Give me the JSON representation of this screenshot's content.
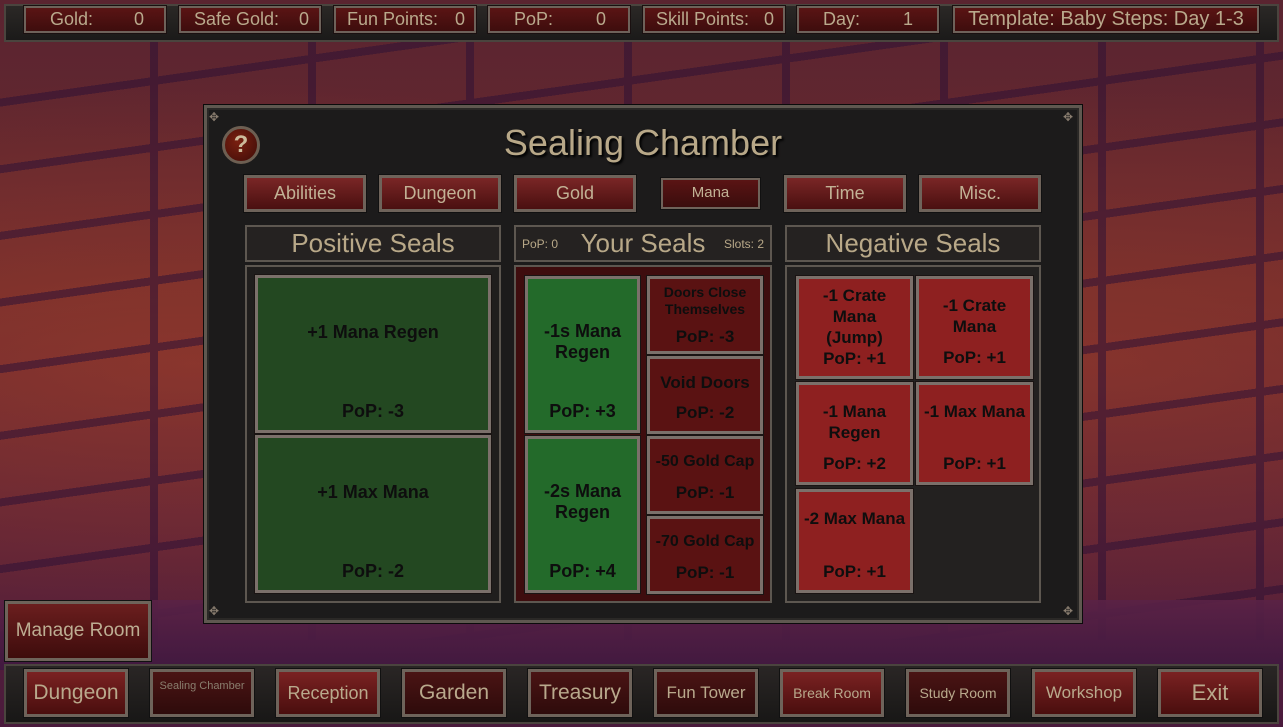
{
  "top_bar": {
    "stats": [
      {
        "label": "Gold:",
        "value": "0"
      },
      {
        "label": "Safe Gold:",
        "value": "0"
      },
      {
        "label": "Fun Points:",
        "value": "0"
      },
      {
        "label": "PoP:",
        "value": "0"
      },
      {
        "label": "Skill Points:",
        "value": "0"
      },
      {
        "label": "Day:",
        "value": "1"
      }
    ],
    "template": "Template: Baby Steps: Day 1-3"
  },
  "panel": {
    "title": "Sealing Chamber",
    "help_icon": "?",
    "tabs": [
      {
        "label": "Abilities",
        "active": false
      },
      {
        "label": "Dungeon",
        "active": false
      },
      {
        "label": "Gold",
        "active": false
      },
      {
        "label": "Mana",
        "active": true
      },
      {
        "label": "Time",
        "active": false
      },
      {
        "label": "Misc.",
        "active": false
      }
    ],
    "positive": {
      "header": "Positive Seals",
      "seals": [
        {
          "name": "+1 Mana Regen",
          "pop": "PoP: -3"
        },
        {
          "name": "+1 Max Mana",
          "pop": "PoP: -2"
        }
      ]
    },
    "your": {
      "header": "Your Seals",
      "pop_label": "PoP:  0",
      "slots_label": "Slots:  2",
      "left_seals": [
        {
          "name": "-1s Mana Regen",
          "pop": "PoP: +3"
        },
        {
          "name": "-2s Mana Regen",
          "pop": "PoP: +4"
        }
      ],
      "right_seals": [
        {
          "name": "Doors Close Themselves",
          "pop": "PoP: -3"
        },
        {
          "name": "Void Doors",
          "pop": "PoP: -2"
        },
        {
          "name": "-50 Gold Cap",
          "pop": "PoP: -1"
        },
        {
          "name": "-70 Gold Cap",
          "pop": "PoP: -1"
        }
      ]
    },
    "negative": {
      "header": "Negative Seals",
      "seals": [
        {
          "name": "-1 Crate Mana (Jump)",
          "pop": "PoP: +1"
        },
        {
          "name": "-1 Crate Mana",
          "pop": "PoP: +1"
        },
        {
          "name": "-1 Mana Regen",
          "pop": "PoP: +2"
        },
        {
          "name": "-1 Max Mana",
          "pop": "PoP: +1"
        },
        {
          "name": "-2 Max Mana",
          "pop": "PoP: +1"
        }
      ]
    }
  },
  "manage_room": "Manage Room",
  "bottom_nav": [
    {
      "label": "Dungeon"
    },
    {
      "label": "Sealing Chamber",
      "current": true
    },
    {
      "label": "Reception"
    },
    {
      "label": "Garden"
    },
    {
      "label": "Treasury"
    },
    {
      "label": "Fun Tower"
    },
    {
      "label": "Break Room"
    },
    {
      "label": "Study Room"
    },
    {
      "label": "Workshop"
    },
    {
      "label": "Exit"
    }
  ],
  "colors": {
    "positive_seal": "#234821",
    "your_positive_seal": "#236a2a",
    "your_negative_seal": "#5a1212",
    "negative_seal": "#8e2020",
    "text_gold": "#b8a888"
  }
}
